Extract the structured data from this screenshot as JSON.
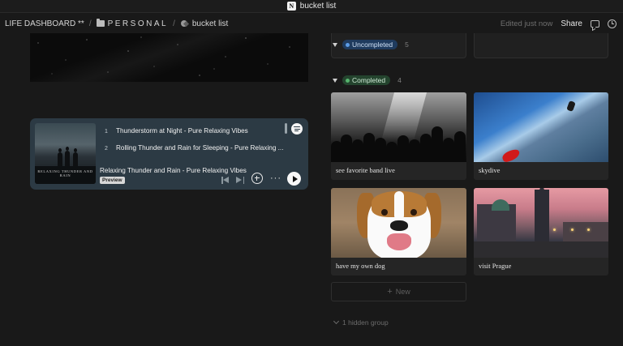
{
  "window": {
    "title": "bucket list",
    "app_icon_letter": "N"
  },
  "breadcrumb": {
    "items": [
      {
        "label": "LIFE DASHBOARD **",
        "icon": "none"
      },
      {
        "label": "PERSONAL",
        "icon": "folder-icon"
      },
      {
        "label": "bucket list",
        "icon": "database-icon"
      }
    ],
    "separator": "/"
  },
  "topbar": {
    "edited": "Edited just now",
    "share": "Share"
  },
  "player": {
    "tracks": [
      {
        "num": "1",
        "title": "Thunderstorm at Night - Pure Relaxing Vibes"
      },
      {
        "num": "2",
        "title": "Rolling Thunder and Rain for Sleeping - Pure Relaxing ..."
      }
    ],
    "now_playing": "Relaxing Thunder and Rain - Pure Relaxing Vibes",
    "preview_badge": "Preview",
    "album_cover_text": "RELAXING THUNDER AND RAIN",
    "more": "···"
  },
  "board": {
    "groups": [
      {
        "label": "Uncompleted",
        "count": "5",
        "color": "#5c9ce6"
      },
      {
        "label": "Completed",
        "count": "4",
        "color": "#56b36d"
      }
    ],
    "cards": [
      {
        "title": "see favorite band live"
      },
      {
        "title": "skydive"
      },
      {
        "title": "have my own dog"
      },
      {
        "title": "visit Prague"
      }
    ],
    "new_label": "New",
    "hidden_group": "1 hidden group"
  }
}
